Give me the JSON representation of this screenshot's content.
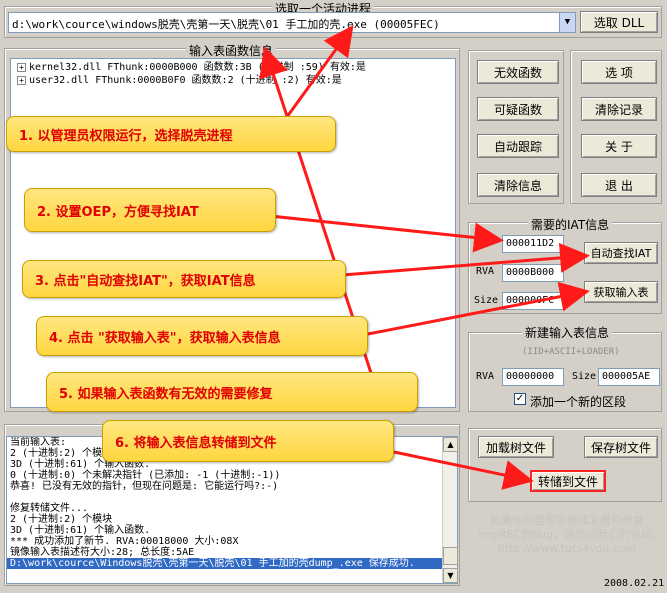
{
  "process": {
    "group_label": "选取一个活动进程",
    "selected": "d:\\work\\cource\\windows脱壳\\壳第一天\\脱壳\\01 手工加的壳.exe (00005FEC)",
    "select_dll": "选取 DLL"
  },
  "imports": {
    "title": "输入表函数信息",
    "rows": [
      "kernel32.dll FThunk:0000B000 函数数:3B (十进制 :59) 有效:是",
      "user32.dll FThunk:0000B0F0 函数数:2 (十进制 :2) 有效:是"
    ]
  },
  "left_buttons": [
    "无效函数",
    "可疑函数",
    "自动跟踪",
    "清除信息"
  ],
  "right_buttons": [
    "选    项",
    "清除记录",
    "关    于",
    "退    出"
  ],
  "iat": {
    "title": "需要的IAT信息",
    "oep_label": "OEP",
    "oep": "000011D2",
    "rva_label": "RVA",
    "rva": "0000B000",
    "size_label": "Size",
    "size": "000000FC",
    "auto_find": "自动查找IAT",
    "get_imports": "获取输入表"
  },
  "new_imports": {
    "title": "新建输入表信息",
    "subtitle": "(IID+ASCII+LOADER)",
    "rva_label": "RVA",
    "rva": "00000000",
    "size_label": "Size",
    "size": "000005AE",
    "add_section": "添加一个新的区段",
    "add_section_checked": true
  },
  "log": {
    "lines": [
      "当前输入表:",
      "2 (十进制:2) 个模块",
      "3D (十进制:61) 个输入函数.",
      "0 (十进制:0) 个未解决指针 (已添加: -1 (十进制:-1))",
      "恭喜! 已没有无效的指针，但现在问题是: 它能运行吗?:-)",
      "",
      "修复转储文件...",
      "2 (十进制:2) 个模块",
      "3D (十进制:61) 个输入函数.",
      "*** 成功添加了新节. RVA:00018000 大小:08X",
      "镜像输入表描述符大小:28; 总长度:5AE",
      "D:\\work\\cource\\Windows脱壳\\壳第一天\\脱壳\\01 手工加的壳dump_.exe 保存成功."
    ]
  },
  "tree_buttons": {
    "load": "加载树文件",
    "save": "保存树文件",
    "dump": "转储到文件"
  },
  "watermark": {
    "line1": "如果你想要帮助继续发展和修复",
    "line2": "impREC的bug，请访问我们的论坛:",
    "line3": "http://www.tuts4you.com"
  },
  "date": "2008.02.21",
  "callouts": [
    "1. 以管理员权限运行，选择脱壳进程",
    "2. 设置OEP，方便寻找IAT",
    "3. 点击\"自动查找IAT\"，获取IAT信息",
    "4. 点击 \"获取输入表\"，获取输入表信息",
    "5. 如果输入表函数有无效的需要修复",
    "6. 将输入表信息转储到文件"
  ],
  "colors": {
    "callout_text": "#e00000",
    "callout_bg": "#ffd640",
    "arrow": "#ff1a1a",
    "selection": "#316ac5"
  }
}
